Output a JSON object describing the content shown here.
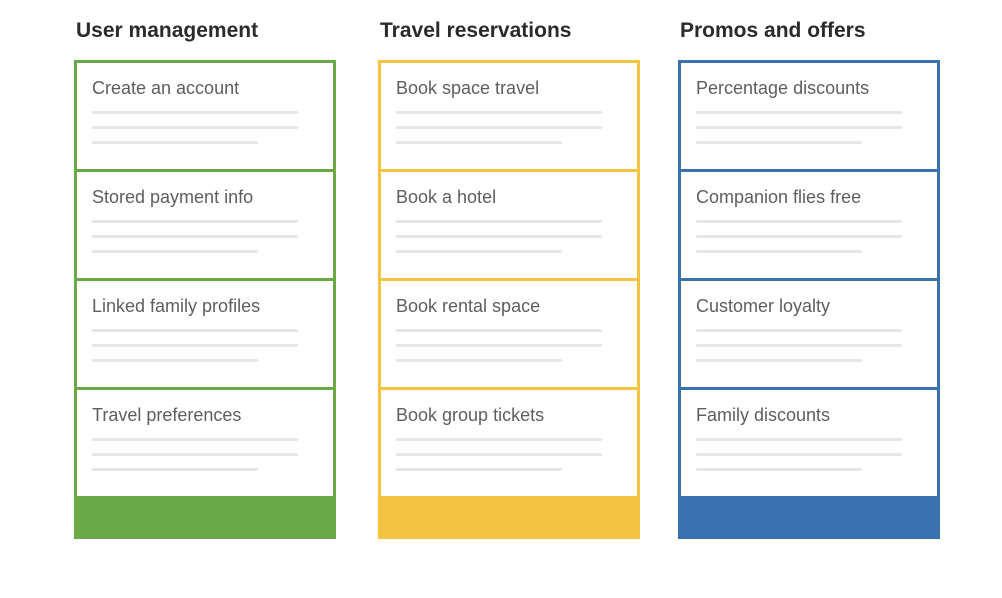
{
  "columns": [
    {
      "title": "User management",
      "accent": "#69aa46",
      "cards": [
        {
          "title": "Create an account"
        },
        {
          "title": "Stored payment info"
        },
        {
          "title": "Linked family profiles"
        },
        {
          "title": "Travel preferences"
        }
      ]
    },
    {
      "title": "Travel reservations",
      "accent": "#f5c342",
      "cards": [
        {
          "title": "Book space travel"
        },
        {
          "title": "Book a hotel"
        },
        {
          "title": "Book rental space"
        },
        {
          "title": "Book group tickets"
        }
      ]
    },
    {
      "title": "Promos and offers",
      "accent": "#3a72b0",
      "cards": [
        {
          "title": "Percentage discounts"
        },
        {
          "title": "Companion flies free"
        },
        {
          "title": "Customer loyalty"
        },
        {
          "title": "Family discounts"
        }
      ]
    }
  ]
}
